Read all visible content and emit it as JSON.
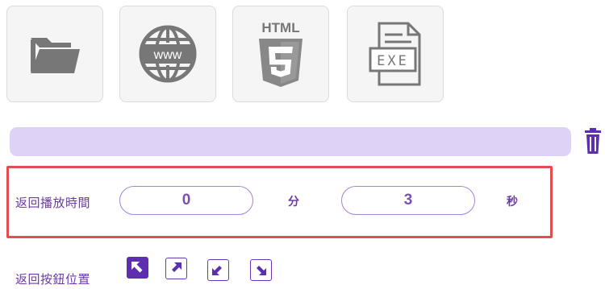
{
  "tiles": [
    {
      "icon": "folder-icon"
    },
    {
      "icon": "www-globe-icon",
      "text": "www"
    },
    {
      "icon": "html5-icon",
      "text": "HTML"
    },
    {
      "icon": "exe-file-icon",
      "text": "EXE"
    }
  ],
  "path_bar": {
    "value": ""
  },
  "return_time": {
    "label": "返回播放時間",
    "minutes": "0",
    "minutes_unit": "分",
    "seconds": "3",
    "seconds_unit": "秒"
  },
  "button_position": {
    "label": "返回按鈕位置",
    "options": [
      {
        "name": "top-left",
        "selected": true
      },
      {
        "name": "top-right",
        "selected": false
      },
      {
        "name": "bottom-left",
        "selected": false
      },
      {
        "name": "bottom-right",
        "selected": false
      }
    ]
  },
  "colors": {
    "accent": "#5d2fb0",
    "text": "#6b3aa5",
    "path_bar": "#ded3f7",
    "highlight_border": "#e24d52",
    "tile_bg": "#f5f5f5",
    "icon_gray": "#777777"
  }
}
